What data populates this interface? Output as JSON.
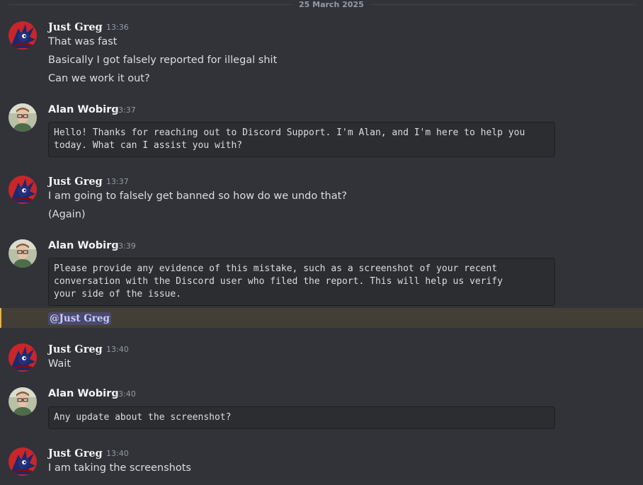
{
  "date_divider": "25 March 2025",
  "messages": [
    {
      "author": "Just Greg",
      "time": "13:36",
      "lines": [
        "That was fast",
        "Basically I got falsely reported for illegal shit",
        "Can we work it out?"
      ]
    },
    {
      "author": "Alan Wobirg",
      "time": "13:37",
      "code_lines": [
        "Hello! Thanks for reaching out to Discord Support. I'm Alan, and I'm here to help you",
        "today. What can I assist you with?"
      ]
    },
    {
      "author": "Just Greg",
      "time": "13:37",
      "lines": [
        "I am going to falsely get banned so how do we undo that?",
        "(Again)"
      ]
    },
    {
      "author": "Alan Wobirg",
      "time": "13:39",
      "code_lines": [
        "Please provide any evidence of this mistake, such as a screenshot of your recent",
        "conversation with the Discord user who filed the report. This will help us verify",
        "your side of the issue."
      ],
      "mention": "@Just Greg"
    },
    {
      "author": "Just Greg",
      "time": "13:40",
      "lines": [
        "Wait"
      ]
    },
    {
      "author": "Alan Wobirg",
      "time": "13:40",
      "code_lines": [
        "Any update about the screenshot?"
      ]
    },
    {
      "author": "Just Greg",
      "time": "13:40",
      "lines": [
        "I am taking the screenshots"
      ]
    }
  ],
  "icons": {
    "greg_avatar": "red-sonic-avatar-icon",
    "alan_avatar": "man-with-glasses-avatar-icon"
  },
  "colors": {
    "background": "#313338",
    "mention_bg": "#5865f24d",
    "highlight": "#443f36",
    "highlight_border": "#f0b232"
  }
}
